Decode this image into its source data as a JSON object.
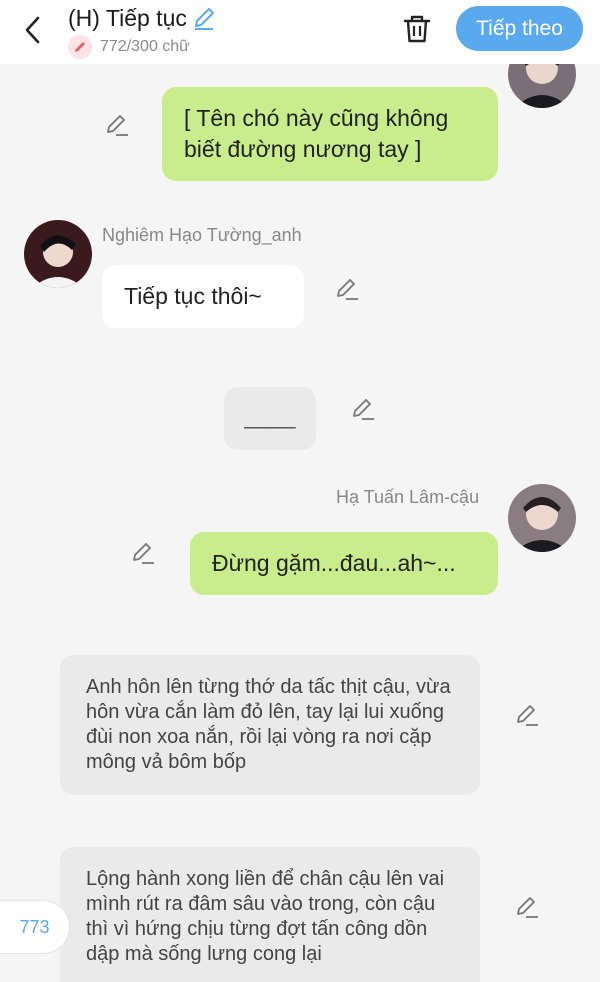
{
  "header": {
    "title": "(H) Tiếp tục",
    "char_count": "772/300 chữ",
    "next_label": "Tiếp theo"
  },
  "messages": {
    "m1": {
      "text": "[ Tên chó này cũng không biết đường nương tay ]"
    },
    "m2": {
      "sender": "Nghiêm Hạo Tường_anh",
      "text": "Tiếp tục thôi~"
    },
    "m3": {
      "text": "____"
    },
    "m4": {
      "sender": "Hạ Tuấn Lâm-cậu",
      "text": "Đừng gặm...đau...ah~..."
    },
    "m5": {
      "text": "Anh hôn lên từng thớ da tấc thịt cậu, vừa hôn vừa cắn làm đỏ lên, tay lại lui xuống đùi non xoa nắn, rồi lại vòng ra nơi cặp mông vả bôm bốp"
    },
    "m6": {
      "text": "Lộng hành xong liền để chân cậu lên vai mình rút ra đâm sâu vào trong, còn cậu thì vì hứng chịu từng đợt tấn công dồn dập mà sống lưng cong lại"
    }
  },
  "page_number": "773",
  "colors": {
    "accent": "#5aa9ef",
    "bubble_green": "#c9ec8d",
    "bubble_white": "#ffffff",
    "bubble_grey": "#eaeaea"
  }
}
